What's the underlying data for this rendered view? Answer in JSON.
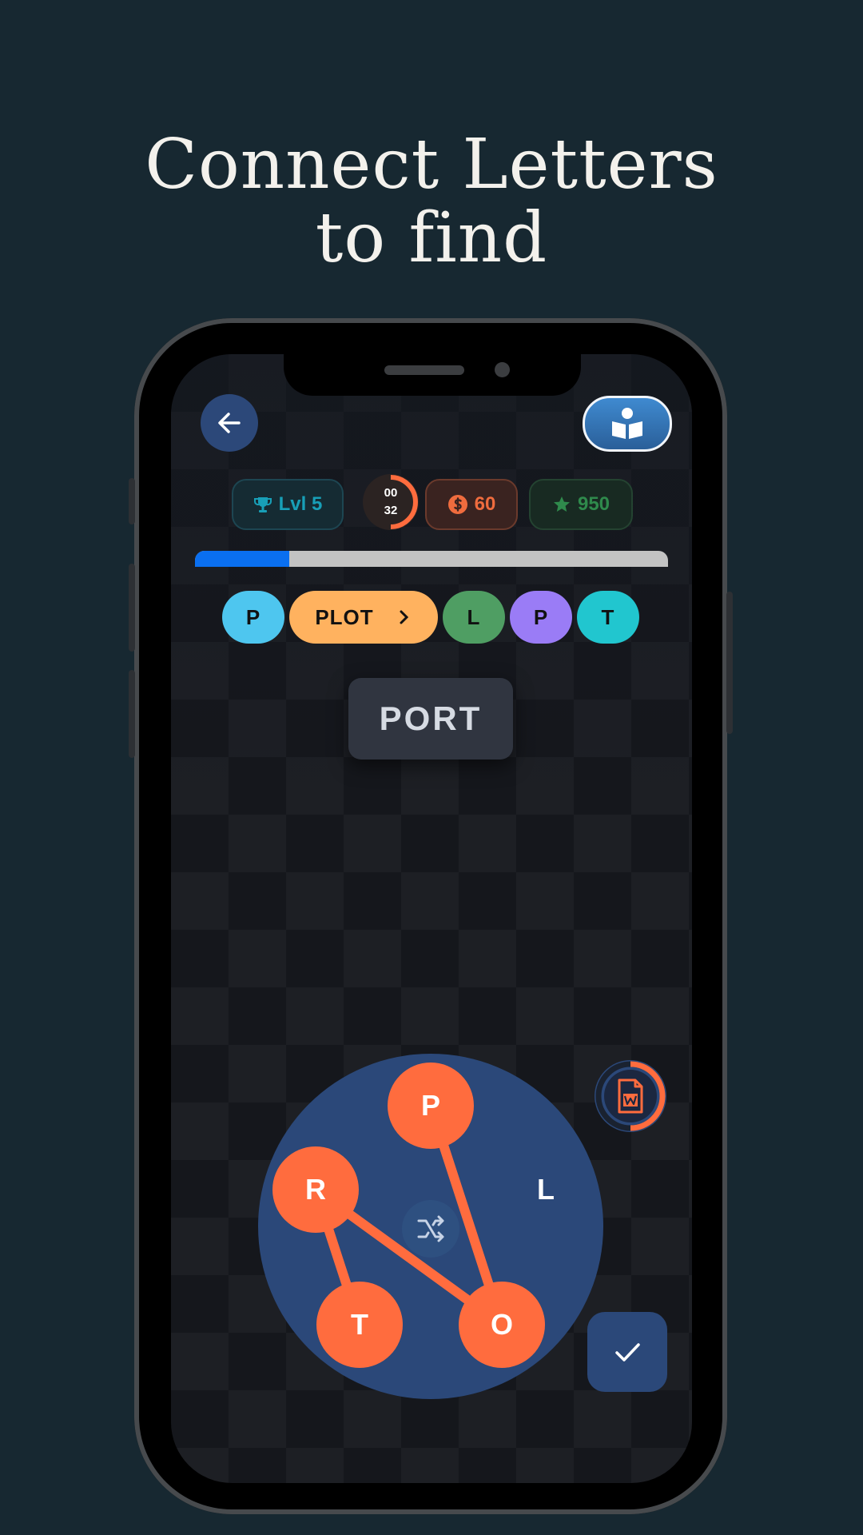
{
  "headline": {
    "line1": "Connect Letters",
    "line2": "to find"
  },
  "stats": {
    "level": "Lvl 5",
    "timer_minutes": "00",
    "timer_seconds": "32",
    "timer_remaining_fraction": 0.5,
    "coins": "60",
    "stars": "950"
  },
  "progress_fraction": 0.2,
  "found_words": [
    {
      "label": "P",
      "color": "#4ec6ef"
    },
    {
      "label": "PLOT",
      "color": "#ffb25f",
      "has_arrow": true
    },
    {
      "label": "L",
      "color": "#4f9e63"
    },
    {
      "label": "P",
      "color": "#9a7cf6"
    },
    {
      "label": "T",
      "color": "#21c6cf"
    }
  ],
  "current_word": "PORT",
  "wheel_letters": [
    {
      "label": "P",
      "selected": true
    },
    {
      "label": "R",
      "selected": true
    },
    {
      "label": "L",
      "selected": false
    },
    {
      "label": "T",
      "selected": true
    },
    {
      "label": "O",
      "selected": true
    }
  ],
  "colors": {
    "background": "#172831",
    "accent_orange": "#ff6c3e",
    "wheel_blue": "#2b4879",
    "progress_blue": "#0a6ff0"
  },
  "icons": {
    "back": "arrow-left-icon",
    "guide": "book-reader-icon",
    "level": "trophy-icon",
    "coins": "dollar-coin-icon",
    "stars": "star-icon",
    "shuffle": "shuffle-icon",
    "hint": "word-file-icon",
    "confirm": "check-icon"
  }
}
